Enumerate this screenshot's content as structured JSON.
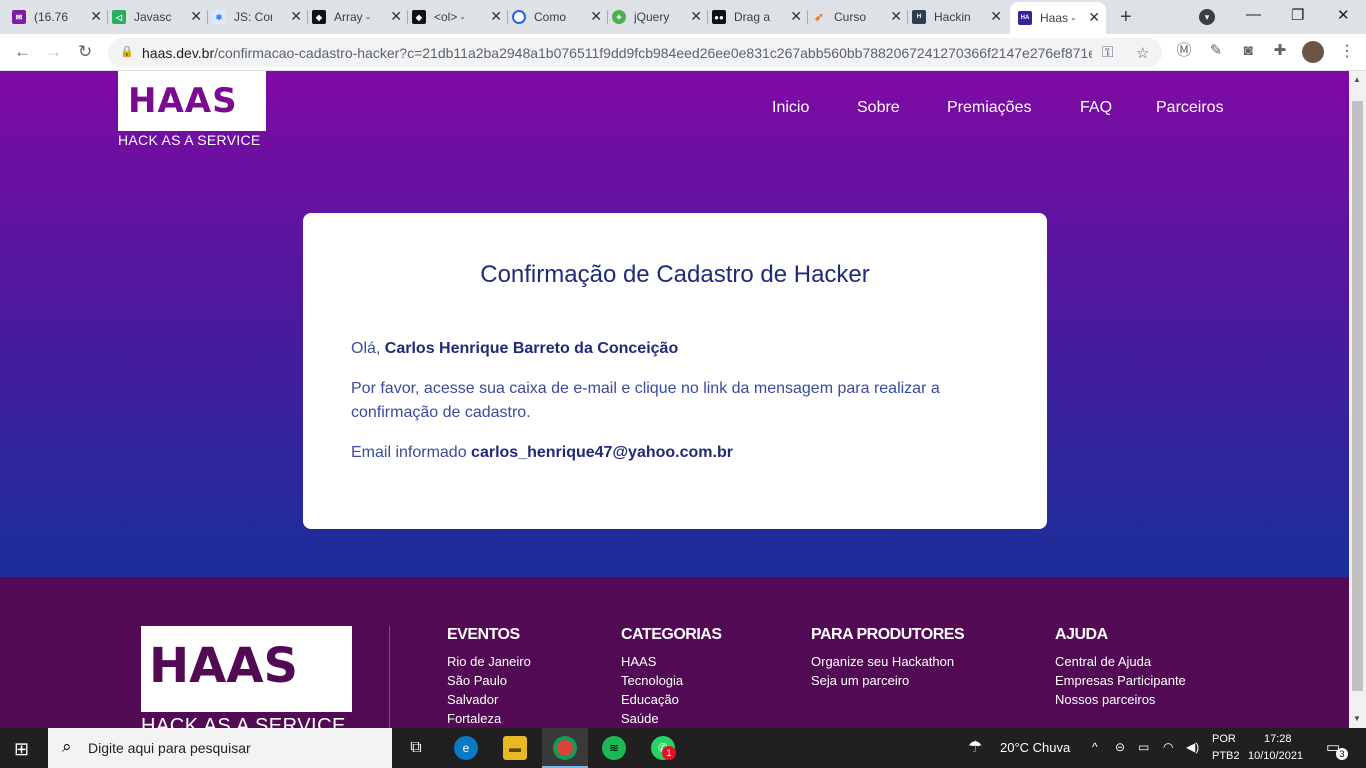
{
  "browser": {
    "tabs": [
      {
        "title": "(16.76",
        "icon": "mail-icon",
        "color": "#7b1fa2"
      },
      {
        "title": "Javascr",
        "icon": "vue-icon",
        "color": "#27ae60"
      },
      {
        "title": "JS: Cor",
        "icon": "snowflake-icon",
        "color": "#3b82f6"
      },
      {
        "title": "Array -",
        "icon": "ghost-icon",
        "color": "#111111"
      },
      {
        "title": "<ol> -",
        "icon": "ghost-icon",
        "color": "#111111"
      },
      {
        "title": "Como",
        "icon": "refresh-icon",
        "color": "#2563eb"
      },
      {
        "title": "jQuery",
        "icon": "jquery-icon",
        "color": "#4caf50"
      },
      {
        "title": "Drag a",
        "icon": "codepen-icon",
        "color": "#111111"
      },
      {
        "title": "Curso",
        "icon": "curso-icon",
        "color": "#e67e22"
      },
      {
        "title": "Hackin",
        "icon": "hack-icon",
        "color": "#2c3e50"
      },
      {
        "title": "Haas -",
        "icon": "haas-icon",
        "color": "#3a1fa0"
      }
    ],
    "url_domain": "haas.dev.br",
    "url_path": "/confirmacao-cadastro-hacker?c=21db11a2ba2948a1b076511f9dd9fcb984eed26ee0e831c267abb560bb7882067241270366f2147e276ef871e..."
  },
  "site": {
    "logo_text": "HAAS",
    "logo_subtitle": "HACK AS A SERVICE",
    "menu": [
      "Inicio",
      "Sobre",
      "Premiações",
      "FAQ",
      "Parceiros"
    ]
  },
  "card": {
    "title": "Confirmação de Cadastro de Hacker",
    "greeting_prefix": "Olá, ",
    "name": "Carlos Henrique Barreto da Conceição",
    "message": "Por favor, acesse sua caixa de e-mail e clique no link da mensagem para realizar a confirmação de cadastro.",
    "email_prefix": "Email informado ",
    "email": "carlos_henrique47@yahoo.com.br"
  },
  "footer": {
    "logo_text": "HAAS",
    "logo_subtitle": "HACK AS A SERVICE",
    "columns": [
      {
        "title": "EVENTOS",
        "items": [
          "Rio de Janeiro",
          "São Paulo",
          "Salvador",
          "Fortaleza"
        ]
      },
      {
        "title": "CATEGORIAS",
        "items": [
          "HAAS",
          "Tecnologia",
          "Educação",
          "Saúde"
        ]
      },
      {
        "title": "PARA PRODUTORES",
        "items": [
          "Organize seu Hackathon",
          "Seja um parceiro"
        ]
      },
      {
        "title": "AJUDA",
        "items": [
          "Central de Ajuda",
          "Empresas Participante",
          "Nossos parceiros"
        ]
      }
    ]
  },
  "taskbar": {
    "search_placeholder": "Digite aqui para pesquisar",
    "weather": "20°C  Chuva",
    "lang": "POR",
    "layout": "PTB2",
    "time": "17:28",
    "date": "10/10/2021",
    "notifications": "3",
    "whatsapp_badge": "1"
  }
}
